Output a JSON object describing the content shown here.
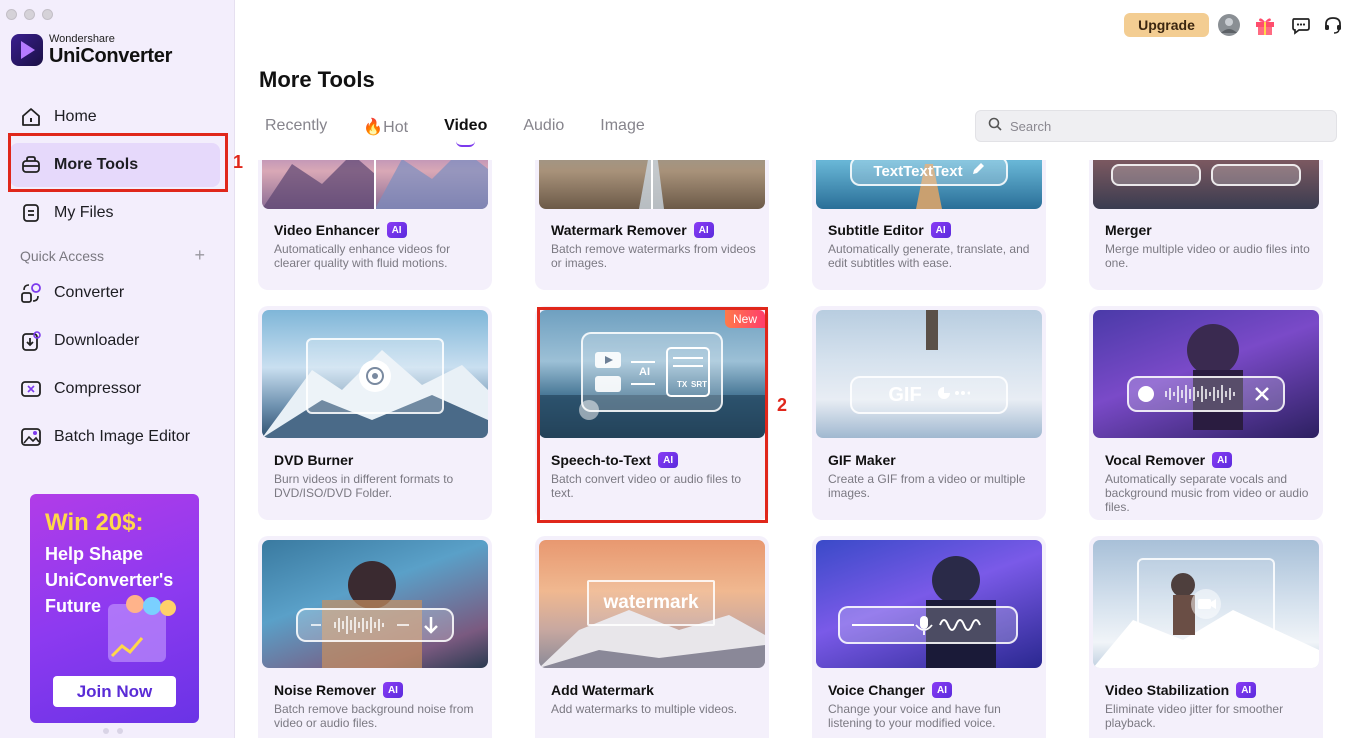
{
  "app": {
    "brand_small": "Wondershare",
    "brand_name": "UniConverter"
  },
  "sidebar": {
    "items": [
      {
        "label": "Home"
      },
      {
        "label": "More Tools"
      },
      {
        "label": "My Files"
      }
    ],
    "quick_access_label": "Quick Access",
    "quick_items": [
      {
        "label": "Converter"
      },
      {
        "label": "Downloader"
      },
      {
        "label": "Compressor"
      },
      {
        "label": "Batch Image Editor"
      }
    ],
    "promo": {
      "title": "Win 20$:",
      "subtitle": "Help Shape UniConverter's Future",
      "button": "Join Now"
    }
  },
  "annotations": {
    "marker_1": "1",
    "marker_2": "2"
  },
  "topbar": {
    "upgrade_label": "Upgrade"
  },
  "page": {
    "title": "More Tools",
    "tabs": [
      {
        "label": "Recently"
      },
      {
        "label": "🔥Hot"
      },
      {
        "label": "Video"
      },
      {
        "label": "Audio"
      },
      {
        "label": "Image"
      }
    ],
    "search_placeholder": "Search"
  },
  "badges": {
    "ai": "AI",
    "new": "New"
  },
  "overlay_text": {
    "subtitle": "TextTextText",
    "gif": "GIF",
    "watermark": "watermark",
    "speech_ai": "AI",
    "speech_tx": "TX",
    "speech_srt": "SRT"
  },
  "cards": [
    {
      "title": "Video Enhancer",
      "ai": true,
      "desc": "Automatically enhance videos for clearer quality with fluid motions."
    },
    {
      "title": "Watermark Remover",
      "ai": true,
      "desc": "Batch remove watermarks from videos or images."
    },
    {
      "title": "Subtitle Editor",
      "ai": true,
      "desc": "Automatically generate, translate, and edit subtitles with ease."
    },
    {
      "title": "Merger",
      "ai": false,
      "desc": "Merge multiple video or audio files into one."
    },
    {
      "title": "DVD Burner",
      "ai": false,
      "desc": "Burn videos in different formats to DVD/ISO/DVD Folder."
    },
    {
      "title": "Speech-to-Text",
      "ai": true,
      "desc": "Batch convert video or audio files to text."
    },
    {
      "title": "GIF Maker",
      "ai": false,
      "desc": "Create a GIF from a video or multiple images."
    },
    {
      "title": "Vocal Remover",
      "ai": true,
      "desc": "Automatically separate vocals and background music from video or audio files."
    },
    {
      "title": "Noise Remover",
      "ai": true,
      "desc": "Batch remove background noise from video or audio files."
    },
    {
      "title": "Add Watermark",
      "ai": false,
      "desc": "Add watermarks to multiple videos."
    },
    {
      "title": "Voice Changer",
      "ai": true,
      "desc": "Change your voice and have fun listening to your modified voice."
    },
    {
      "title": "Video Stabilization",
      "ai": true,
      "desc": "Eliminate video jitter for smoother playback."
    }
  ]
}
